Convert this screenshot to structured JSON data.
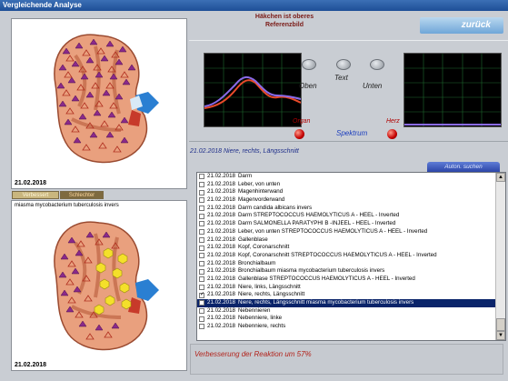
{
  "window": {
    "title": "Vergleichende Analyse"
  },
  "header": {
    "heading_line1": "Häkchen ist oberes",
    "heading_line2": "Referenzbild",
    "back_label": "zurück"
  },
  "left_panel": {
    "top_date": "21.02.2018",
    "tab_improved": "Verbessert",
    "tab_worse": "Schlechter",
    "bottom_caption": "miasma mycobacterium tuberculosis invers",
    "bottom_date": "21.02.2018"
  },
  "controls": {
    "oben": "Oben",
    "text": "Text",
    "unten": "Unten",
    "organ": "Organ",
    "herz": "Herz",
    "spektrum": "Spektrum"
  },
  "info_line": "21.02.2018 Niere, rechts, Längsschnitt",
  "list": {
    "filter_button": "Auton. suchen",
    "rows": [
      {
        "date": "21.02.2018",
        "text": "Darm",
        "checked": false,
        "selected": false
      },
      {
        "date": "21.02.2018",
        "text": "Leber, von unten",
        "checked": false,
        "selected": false
      },
      {
        "date": "21.02.2018",
        "text": "Magenhinterwand",
        "checked": false,
        "selected": false
      },
      {
        "date": "21.02.2018",
        "text": "Magenvorderwand",
        "checked": false,
        "selected": false
      },
      {
        "date": "21.02.2018",
        "text": "Darm   candida albicans invers",
        "checked": false,
        "selected": false
      },
      {
        "date": "21.02.2018",
        "text": "Darm  STREPTOCOCCUS HAEMOLYTICUS A   - HEEL - Inverted",
        "checked": false,
        "selected": false
      },
      {
        "date": "21.02.2018",
        "text": "Darm  SALMONELLA PARATYPHI B -INJEEL - HEEL - Inverted",
        "checked": false,
        "selected": false
      },
      {
        "date": "21.02.2018",
        "text": "Leber, von unten  STREPTOCOCCUS HAEMOLYTICUS A   - HEEL - Inverted",
        "checked": false,
        "selected": false
      },
      {
        "date": "21.02.2018",
        "text": "Gallenblase",
        "checked": false,
        "selected": false
      },
      {
        "date": "21.02.2018",
        "text": "Kopf, Coronarschnitt",
        "checked": false,
        "selected": false
      },
      {
        "date": "21.02.2018",
        "text": "Kopf, Coronarschnitt  STREPTOCOCCUS HAEMOLYTICUS A   - HEEL - Inverted",
        "checked": false,
        "selected": false
      },
      {
        "date": "21.02.2018",
        "text": "Bronchialbaum",
        "checked": false,
        "selected": false
      },
      {
        "date": "21.02.2018",
        "text": "Bronchialbaum  miasma mycobacterium tuberculosis invers",
        "checked": false,
        "selected": false
      },
      {
        "date": "21.02.2018",
        "text": "Gallenblase  STREPTOCOCCUS HAEMOLYTICUS A   - HEEL - Inverted",
        "checked": false,
        "selected": false
      },
      {
        "date": "21.02.2018",
        "text": "Niere, links, Längsschnitt",
        "checked": false,
        "selected": false
      },
      {
        "date": "21.02.2018",
        "text": "Niere, rechts, Längsschnitt",
        "checked": true,
        "selected": false
      },
      {
        "date": "21.02.2018",
        "text": "Niere, rechts, Längsschnitt  miasma mycobacterium tuberculosis invers",
        "checked": false,
        "selected": true
      },
      {
        "date": "21.02.2018",
        "text": "Nebennieren",
        "checked": false,
        "selected": false
      },
      {
        "date": "21.02.2018",
        "text": "Nebenniere, linke",
        "checked": false,
        "selected": false
      },
      {
        "date": "21.02.2018",
        "text": "Nebenniere, rechts",
        "checked": false,
        "selected": false
      }
    ]
  },
  "status": {
    "text": "Verbesserung der Reaktion um 57%"
  }
}
